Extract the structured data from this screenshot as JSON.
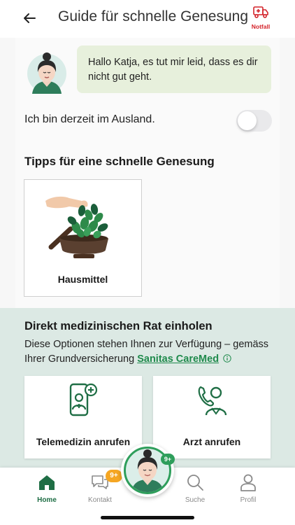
{
  "header": {
    "title": "Guide für schnelle Genesung",
    "emergency_label": "Notfall"
  },
  "greeting": {
    "message": "Hallo Katja, es tut mir leid, dass es dir nicht gut geht."
  },
  "abroad": {
    "label": "Ich bin derzeit im Ausland.",
    "toggle_on": false
  },
  "tips": {
    "heading": "Tipps für eine schnelle Genesung",
    "items": [
      {
        "label": "Hausmittel"
      }
    ]
  },
  "advice": {
    "heading": "Direkt medizinischen Rat einholen",
    "text": "Diese Optionen stehen Ihnen zur Verfügung – gemäss Ihrer Grundversicherung",
    "link": "Sanitas CareMed",
    "options": [
      {
        "label": "Telemedizin anrufen"
      },
      {
        "label": "Arzt anrufen"
      }
    ]
  },
  "tabbar": {
    "items": [
      {
        "label": "Home",
        "active": true
      },
      {
        "label": "Kontakt",
        "badge": "9+"
      },
      {
        "label": "Suche"
      },
      {
        "label": "Profil"
      }
    ],
    "assistant_badge": "9+"
  },
  "colors": {
    "brand_green": "#1f6e45",
    "accent_green": "#2e9e5b",
    "link_green": "#1f8a4c",
    "bubble_bg": "#e7f0dc",
    "advice_bg": "#dce9e4",
    "emergency_red": "#d4232a",
    "badge_orange": "#f5a623"
  }
}
